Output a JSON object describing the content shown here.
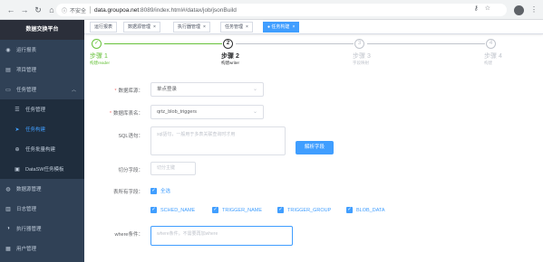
{
  "browser": {
    "secure_label": "不安全",
    "url_host": "data.groupoa.net",
    "url_path": ":8089/index.html#/datax/job/jsonBuild"
  },
  "sidebar": {
    "brand": "数据交换平台",
    "items": [
      {
        "label": "运行报表",
        "icon": "dashboard-icon"
      },
      {
        "label": "项目管理",
        "icon": "project-icon"
      },
      {
        "label": "任务管理",
        "icon": "task-icon"
      },
      {
        "label": "任务管理",
        "icon": "list-icon"
      },
      {
        "label": "任务构建",
        "icon": "send-icon"
      },
      {
        "label": "任务批量构建",
        "icon": "batch-icon"
      },
      {
        "label": "DataSW任务模板",
        "icon": "template-icon"
      },
      {
        "label": "数据源管理",
        "icon": "database-icon"
      },
      {
        "label": "日志管理",
        "icon": "log-icon"
      },
      {
        "label": "执行器管理",
        "icon": "executor-icon"
      },
      {
        "label": "用户管理",
        "icon": "user-icon"
      }
    ]
  },
  "tags": [
    {
      "label": "运行报表"
    },
    {
      "label": "数据源管理"
    },
    {
      "label": "执行器管理"
    },
    {
      "label": "任务管理"
    },
    {
      "label": "任务构建"
    }
  ],
  "steps": [
    {
      "index": "✓",
      "title": "步骤 1",
      "desc": "构建reader"
    },
    {
      "index": "2",
      "title": "步骤 2",
      "desc": "构建writer"
    },
    {
      "index": "3",
      "title": "步骤 3",
      "desc": "字段映射"
    },
    {
      "index": "4",
      "title": "步骤 4",
      "desc": "构建"
    }
  ],
  "form": {
    "datasource_label": "数据库源：",
    "datasource_value": "单点登录",
    "table_label": "数据库表名：",
    "table_value": "qrtz_blob_triggers",
    "sql_label": "SQL语句：",
    "sql_placeholder": "sql語句，一般用于多表关联查询时才用",
    "parse_button": "解析字段",
    "split_label": "切分字段：",
    "split_placeholder": "切分主键",
    "columns_label": "表所有字段：",
    "select_all": "全选",
    "columns": [
      "SCHED_NAME",
      "TRIGGER_NAME",
      "TRIGGER_GROUP",
      "BLOB_DATA"
    ],
    "where_label": "where条件：",
    "where_placeholder": "where条件，不需要再加where"
  },
  "colors": {
    "primary": "#409eff",
    "success": "#67c23a",
    "sidebar_bg": "#304156",
    "danger": "#f56c6c"
  }
}
